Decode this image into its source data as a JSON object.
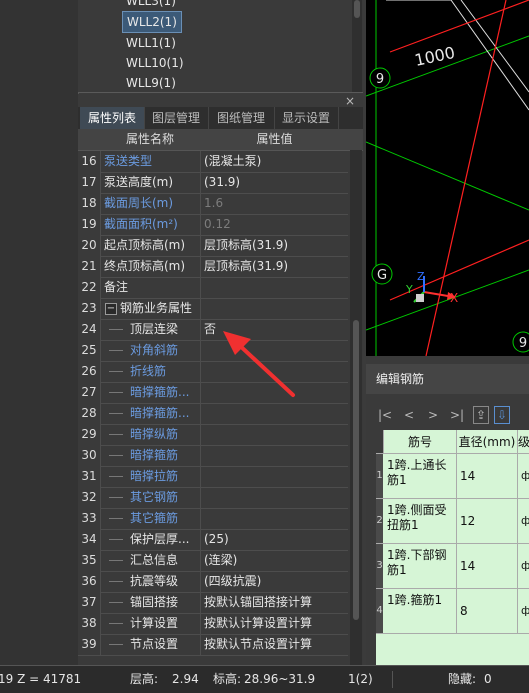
{
  "top_list": {
    "items": [
      {
        "label": "WLL3(1)",
        "selected": false
      },
      {
        "label": "WLL2(1)",
        "selected": true
      },
      {
        "label": "WLL1(1)",
        "selected": false
      },
      {
        "label": "WLL10(1)",
        "selected": false
      },
      {
        "label": "WLL9(1)",
        "selected": false
      }
    ]
  },
  "panel": {
    "close_label": "×",
    "tabs": [
      {
        "label": "属性列表",
        "active": true
      },
      {
        "label": "图层管理",
        "active": false
      },
      {
        "label": "图纸管理",
        "active": false
      },
      {
        "label": "显示设置",
        "active": false
      }
    ],
    "columns": {
      "name": "属性名称",
      "value": "属性值"
    },
    "rows": [
      {
        "num": "16",
        "name": "泵送类型",
        "value": "(混凝土泵)",
        "name_style": "blue",
        "value_style": "white"
      },
      {
        "num": "17",
        "name": "泵送高度(m)",
        "value": "(31.9)",
        "name_style": "white",
        "value_style": "white"
      },
      {
        "num": "18",
        "name": "截面周长(m)",
        "value": "1.6",
        "name_style": "blue",
        "value_style": "gray"
      },
      {
        "num": "19",
        "name": "截面面积(m²)",
        "value": "0.12",
        "name_style": "blue",
        "value_style": "gray"
      },
      {
        "num": "20",
        "name": "起点顶标高(m)",
        "value": "层顶标高(31.9)",
        "name_style": "white",
        "value_style": "white"
      },
      {
        "num": "21",
        "name": "终点顶标高(m)",
        "value": "层顶标高(31.9)",
        "name_style": "white",
        "value_style": "white"
      },
      {
        "num": "22",
        "name": "备注",
        "value": "",
        "name_style": "white",
        "value_style": "white"
      },
      {
        "num": "23",
        "name": "钢筋业务属性",
        "value": "",
        "name_style": "white",
        "value_style": "white",
        "group": true,
        "collapse": "−"
      },
      {
        "num": "24",
        "name": "顶层连梁",
        "value": "否",
        "name_style": "white",
        "value_style": "white",
        "child": true
      },
      {
        "num": "25",
        "name": "对角斜筋",
        "value": "",
        "name_style": "blue",
        "value_style": "white",
        "child": true
      },
      {
        "num": "26",
        "name": "折线筋",
        "value": "",
        "name_style": "blue",
        "value_style": "white",
        "child": true
      },
      {
        "num": "27",
        "name": "暗撑箍筋...",
        "value": "",
        "name_style": "blue",
        "value_style": "white",
        "child": true
      },
      {
        "num": "28",
        "name": "暗撑箍筋...",
        "value": "",
        "name_style": "blue",
        "value_style": "white",
        "child": true
      },
      {
        "num": "29",
        "name": "暗撑纵筋",
        "value": "",
        "name_style": "blue",
        "value_style": "white",
        "child": true
      },
      {
        "num": "30",
        "name": "暗撑箍筋",
        "value": "",
        "name_style": "blue",
        "value_style": "white",
        "child": true
      },
      {
        "num": "31",
        "name": "暗撑拉筋",
        "value": "",
        "name_style": "blue",
        "value_style": "white",
        "child": true
      },
      {
        "num": "32",
        "name": "其它钢筋",
        "value": "",
        "name_style": "blue",
        "value_style": "white",
        "child": true
      },
      {
        "num": "33",
        "name": "其它箍筋",
        "value": "",
        "name_style": "blue",
        "value_style": "white",
        "child": true
      },
      {
        "num": "34",
        "name": "保护层厚...",
        "value": "(25)",
        "name_style": "white",
        "value_style": "white",
        "child": true
      },
      {
        "num": "35",
        "name": "汇总信息",
        "value": "(连梁)",
        "name_style": "white",
        "value_style": "white",
        "child": true
      },
      {
        "num": "36",
        "name": "抗震等级",
        "value": "(四级抗震)",
        "name_style": "white",
        "value_style": "white",
        "child": true
      },
      {
        "num": "37",
        "name": "锚固搭接",
        "value": "按默认锚固搭接计算",
        "name_style": "white",
        "value_style": "white",
        "child": true
      },
      {
        "num": "38",
        "name": "计算设置",
        "value": "按默认计算设置计算",
        "name_style": "white",
        "value_style": "white",
        "child": true
      },
      {
        "num": "39",
        "name": "节点设置",
        "value": "按默认节点设置计算",
        "name_style": "white",
        "value_style": "white",
        "child": true
      }
    ]
  },
  "cad": {
    "dimension_text": "1000",
    "axis_labels": [
      "9",
      "G",
      "9"
    ],
    "triad": {
      "x": "X",
      "y": "Y",
      "z": "Z"
    },
    "colors": {
      "grid_line": "#00c800",
      "axis_line": "#ff2020",
      "triad_x": "#ff3030",
      "triad_y": "#30d030",
      "triad_z": "#3070ff"
    }
  },
  "rebar": {
    "title": "编辑钢筋",
    "toolbar": [
      "|<",
      "<",
      ">",
      ">|",
      "⇪",
      "⇩"
    ],
    "columns": {
      "name": "筋号",
      "diameter": "直径(mm)",
      "grade": "级"
    },
    "rows": [
      {
        "idx": "1",
        "name": "1跨.上通长筋1",
        "diameter": "14",
        "grade": "ф"
      },
      {
        "idx": "2",
        "name": "1跨.侧面受扭筋1",
        "diameter": "12",
        "grade": "ф"
      },
      {
        "idx": "3",
        "name": "1跨.下部钢筋1",
        "diameter": "14",
        "grade": "ф"
      },
      {
        "idx": "4",
        "name": "1跨.箍筋1",
        "diameter": "8",
        "grade": "ф"
      }
    ]
  },
  "status": {
    "coords": "19 Z = 41781",
    "floor_height_label": "层高:",
    "floor_height": "2.94",
    "elevation_label": "标高:",
    "elevation": "28.96~31.9",
    "count": "1(2)",
    "hidden_label": "隐藏:",
    "hidden": "0"
  }
}
